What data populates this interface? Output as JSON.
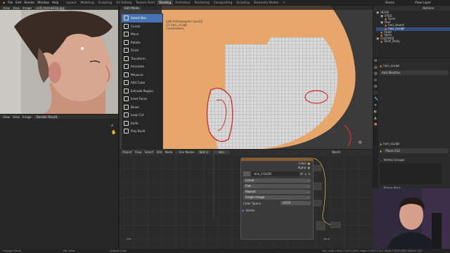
{
  "app": {
    "menus": [
      "File",
      "Edit",
      "Render",
      "Window",
      "Help"
    ],
    "workspaces": [
      "Layout",
      "Modeling",
      "Sculpting",
      "UV Editing",
      "Texture Paint",
      "Shading",
      "Animation",
      "Rendering",
      "Compositing",
      "Scripting",
      "Geometry Nodes",
      "+"
    ],
    "active_workspace_index": 5,
    "scene_label": "Scene",
    "view_layer_label": "View Layer"
  },
  "image_editor": {
    "header": [
      "View",
      "View",
      "Image"
    ],
    "image_name": "cc0_haircutclip.jpg",
    "footer_header": [
      "View",
      "View",
      "Image"
    ],
    "render_result": "Render Result"
  },
  "viewport": {
    "mode": "Edit Mode",
    "overlay_text_1": "Left Orthographic (Local)",
    "overlay_text_2": "(1) hair_sculpt",
    "overlay_text_3": "Centimeters"
  },
  "tool_menu": {
    "items": [
      {
        "label": "Select Box",
        "active": true
      },
      {
        "label": "Cursor",
        "active": false
      },
      {
        "label": "Move",
        "active": false
      },
      {
        "label": "Rotate",
        "active": false
      },
      {
        "label": "Scale",
        "active": false
      },
      {
        "label": "Transform",
        "active": false
      },
      {
        "label": "Annotate",
        "active": false
      },
      {
        "label": "Measure",
        "active": false
      },
      {
        "label": "Add Cube",
        "active": false
      },
      {
        "label": "Extrude Region",
        "active": false
      },
      {
        "label": "Inset Faces",
        "active": false
      },
      {
        "label": "Bevel",
        "active": false
      },
      {
        "label": "Loop Cut",
        "active": false
      },
      {
        "label": "Knife",
        "active": false
      },
      {
        "label": "Poly Build",
        "active": false
      }
    ]
  },
  "node_editor": {
    "header": [
      "Object",
      "View",
      "Select",
      "Add",
      "Node"
    ],
    "use_nodes_label": "Use Nodes",
    "slot_label": "Slot 1",
    "material_label": "skin",
    "world_label": "World",
    "footer_left": "skin",
    "footer_right": "Vorm",
    "node": {
      "out_color": "Color",
      "out_alpha": "Alpha",
      "image_name": "skin_COLOR",
      "interpolation": "Linear",
      "projection": "Flat",
      "extension": "Repeat",
      "source": "Single Image",
      "color_space_label": "Color Space",
      "color_space_value": "sRGB",
      "in_vector": "Vector"
    }
  },
  "outliner": {
    "header": "Options",
    "items": [
      "HEAD",
      "EYES",
      "Eyes",
      "Hair",
      "hair_beard",
      "hair_sculpt",
      "head",
      "Vorm",
      "CLOTHES",
      "Shirt_Body"
    ]
  },
  "properties": {
    "object_name": "hair_sculpt",
    "add_modifier": "Add Modifier",
    "data_name": "hair_sculpt",
    "mesh_name": "Plane.012",
    "vertex_groups": "Vertex Groups",
    "shape_keys": "Shape Keys"
  },
  "status_bar": {
    "left": "Change Frame",
    "middle": "Pan View",
    "right_hint": "Sample Color",
    "stats": "hair_sculpt | Verts 2,347/11,834 | Edges 4,555/21,354 | Faces 2,181/9,588 | Objects 1/31"
  },
  "colors": {
    "accent": "#4772b3",
    "skin_face": "#e8a76a",
    "mesh_selected": "#d03030",
    "node_header": "#8a5b2c"
  }
}
